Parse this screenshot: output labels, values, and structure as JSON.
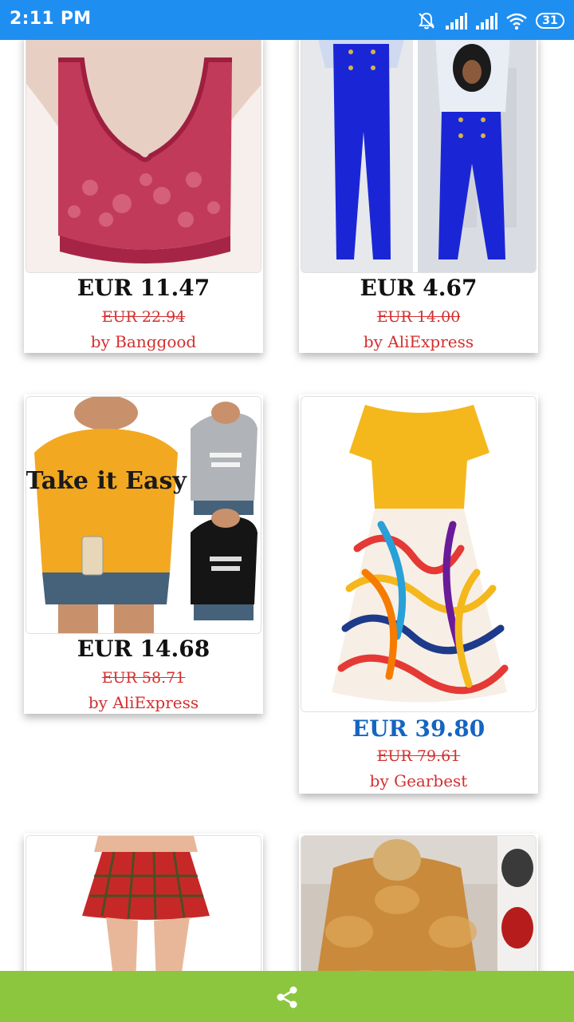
{
  "status_bar": {
    "time": "2:11 PM",
    "battery": "31"
  },
  "products": [
    {
      "price": "EUR 11.47",
      "old_price": "EUR 22.94",
      "vendor": "by Banggood",
      "image": "red-lace-bra"
    },
    {
      "price": "EUR 4.67",
      "old_price": "EUR 14.00",
      "vendor": "by AliExpress",
      "image": "blue-wide-leg-pants"
    },
    {
      "price": "EUR 14.68",
      "old_price": "EUR 58.71",
      "vendor": "by AliExpress",
      "image": "take-it-easy-sweatshirt"
    },
    {
      "price": "EUR 39.80",
      "old_price": "EUR 79.61",
      "vendor": "by Gearbest",
      "image": "yellow-swirl-dress"
    },
    {
      "image": "red-plaid-skirt"
    },
    {
      "image": "fur-coat"
    }
  ],
  "sweatshirt_print": "Take it Easy",
  "colors": {
    "status_bar": "#1f8ef1",
    "bottom_bar": "#8cc63f",
    "price_highlight": "#1565c0",
    "vendor_text": "#d32f2f"
  },
  "bottom_bar": {
    "share_icon": "share-icon"
  }
}
